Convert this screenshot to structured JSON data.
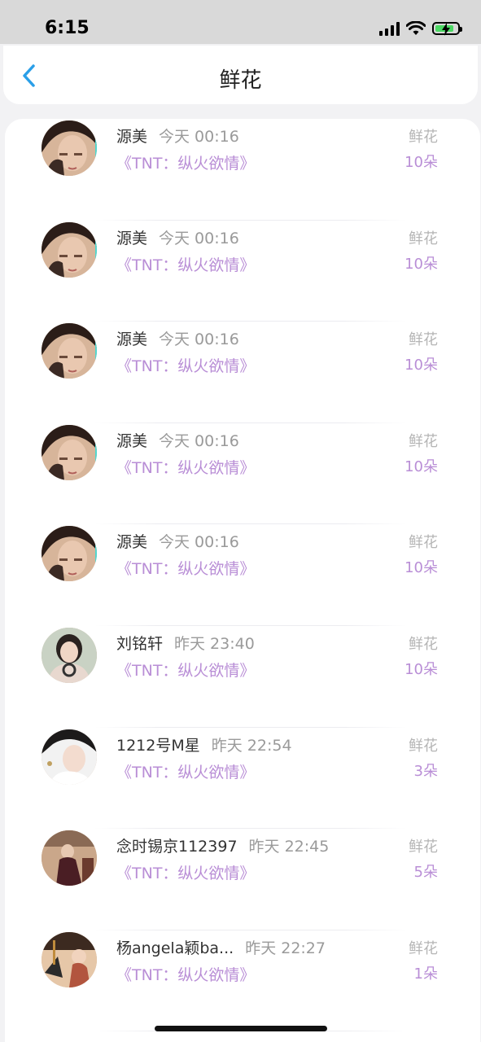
{
  "status_bar": {
    "time": "6:15"
  },
  "nav": {
    "title": "鲜花"
  },
  "rows": [
    {
      "name": "源美",
      "time": "今天 00:16",
      "book": "《TNT：纵火欲情》",
      "gift_label": "鲜花",
      "gift_count": "10朵",
      "avatar": "a"
    },
    {
      "name": "源美",
      "time": "今天 00:16",
      "book": "《TNT：纵火欲情》",
      "gift_label": "鲜花",
      "gift_count": "10朵",
      "avatar": "a"
    },
    {
      "name": "源美",
      "time": "今天 00:16",
      "book": "《TNT：纵火欲情》",
      "gift_label": "鲜花",
      "gift_count": "10朵",
      "avatar": "a"
    },
    {
      "name": "源美",
      "time": "今天 00:16",
      "book": "《TNT：纵火欲情》",
      "gift_label": "鲜花",
      "gift_count": "10朵",
      "avatar": "a"
    },
    {
      "name": "源美",
      "time": "今天 00:16",
      "book": "《TNT：纵火欲情》",
      "gift_label": "鲜花",
      "gift_count": "10朵",
      "avatar": "a"
    },
    {
      "name": "刘铭轩",
      "time": "昨天 23:40",
      "book": "《TNT：纵火欲情》",
      "gift_label": "鲜花",
      "gift_count": "10朵",
      "avatar": "b"
    },
    {
      "name": "1212号M星",
      "time": "昨天 22:54",
      "book": "《TNT：纵火欲情》",
      "gift_label": "鲜花",
      "gift_count": "3朵",
      "avatar": "c"
    },
    {
      "name": "念时锡京112397",
      "time": "昨天 22:45",
      "book": "《TNT：纵火欲情》",
      "gift_label": "鲜花",
      "gift_count": "5朵",
      "avatar": "d"
    },
    {
      "name": "杨angela颖ba...",
      "time": "昨天 22:27",
      "book": "《TNT：纵火欲情》",
      "gift_label": "鲜花",
      "gift_count": "1朵",
      "avatar": "e"
    }
  ],
  "colors": {
    "accent_purple": "#b98ed6",
    "back_blue": "#2a9fe8"
  },
  "icons": {
    "back": "chevron-left-icon",
    "signal": "signal-icon",
    "wifi": "wifi-icon",
    "battery": "battery-charging-icon"
  }
}
